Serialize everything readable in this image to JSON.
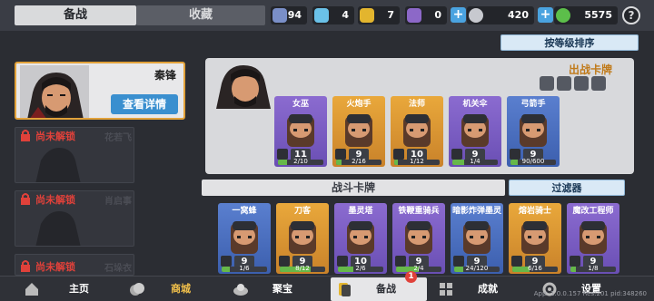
{
  "top_tabs": {
    "active": "备战",
    "inactive": "收藏"
  },
  "resources": [
    {
      "name": "blue-gem",
      "value": "94",
      "color": "#7a8fc8"
    },
    {
      "name": "crystal",
      "value": "4",
      "color": "#6ac1e8"
    },
    {
      "name": "gold-shield",
      "value": "7",
      "color": "#e3b52e"
    },
    {
      "name": "purple-shield",
      "value": "0",
      "color": "#8c68c8"
    },
    {
      "name": "silver-coin",
      "value": "420",
      "color": "#c7c9cf"
    },
    {
      "name": "green-gem",
      "value": "5575",
      "color": "#5cbf4a"
    }
  ],
  "hero": {
    "name": "秦锋",
    "detail_button": "查看详情"
  },
  "locked_heroes": [
    {
      "status": "尚未解锁",
      "name": "花若飞"
    },
    {
      "status": "尚未解锁",
      "name": "肖启事"
    },
    {
      "status": "尚未解锁",
      "name": "石垛衣"
    }
  ],
  "sort_button": "按等级排序",
  "battle_panel": {
    "title": "出战卡牌",
    "cards": [
      {
        "name": "女巫",
        "level": "11",
        "progress": "2/10",
        "fill": 0.2,
        "rarity": "purple"
      },
      {
        "name": "火炮手",
        "level": "9",
        "progress": "2/16",
        "fill": 0.125,
        "rarity": "orange"
      },
      {
        "name": "法师",
        "level": "10",
        "progress": "1/12",
        "fill": 0.08,
        "rarity": "orange"
      },
      {
        "name": "机关伞",
        "level": "9",
        "progress": "1/4",
        "fill": 0.25,
        "rarity": "purple"
      },
      {
        "name": "弓箭手",
        "level": "9",
        "progress": "90/600",
        "fill": 0.15,
        "rarity": "blue"
      }
    ]
  },
  "deck": {
    "title": "战斗卡牌",
    "filter_button": "过滤器",
    "cards": [
      {
        "name": "一窝蜂",
        "level": "9",
        "progress": "1/6",
        "fill": 0.17,
        "rarity": "blue"
      },
      {
        "name": "刀客",
        "level": "9",
        "progress": "8/12",
        "fill": 0.67,
        "rarity": "orange"
      },
      {
        "name": "墨灵塔",
        "level": "10",
        "progress": "2/6",
        "fill": 0.33,
        "rarity": "purple"
      },
      {
        "name": "铁鞭重骑兵",
        "level": "9",
        "progress": "2/4",
        "fill": 0.5,
        "rarity": "purple"
      },
      {
        "name": "暗影炸弹墨灵",
        "level": "9",
        "progress": "24/120",
        "fill": 0.2,
        "rarity": "blue"
      },
      {
        "name": "熔岩骑士",
        "level": "9",
        "progress": "6/16",
        "fill": 0.37,
        "rarity": "orange"
      },
      {
        "name": "魔改工程师",
        "level": "9",
        "progress": "1/8",
        "fill": 0.12,
        "rarity": "purple"
      }
    ]
  },
  "bottom_nav": [
    {
      "label": "主页"
    },
    {
      "label": "商城"
    },
    {
      "label": "聚宝"
    },
    {
      "label": "备战",
      "badge": "1"
    },
    {
      "label": "成就"
    },
    {
      "label": "设置"
    }
  ],
  "version": "App: 1.0.0.157 Res:201 pid:348260"
}
